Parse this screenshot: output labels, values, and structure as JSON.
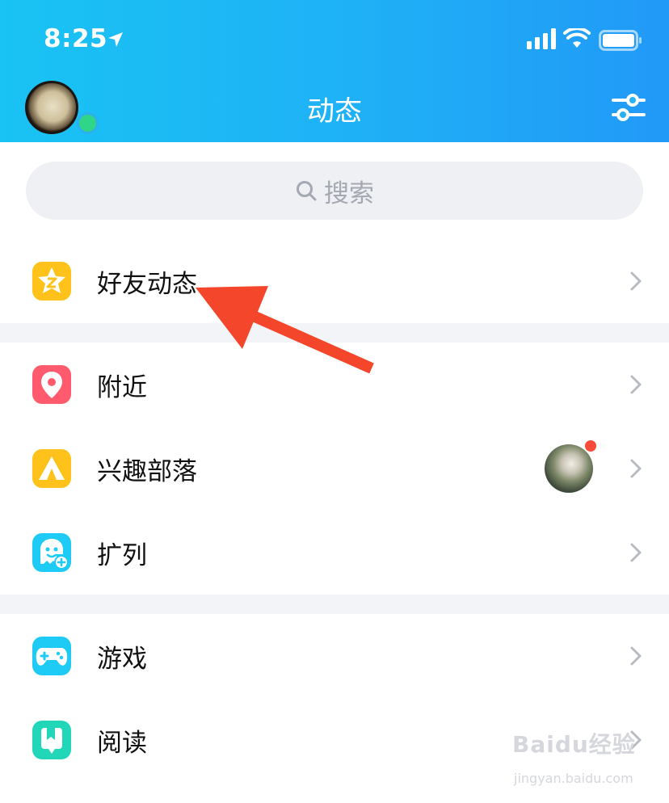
{
  "status_bar": {
    "time": "8:25"
  },
  "header": {
    "title": "动态"
  },
  "search": {
    "placeholder": "搜索"
  },
  "menu": {
    "friends": {
      "label": "好友动态",
      "icon": "star-icon",
      "color": "#FFC21A"
    },
    "nearby": {
      "label": "附近",
      "icon": "location-pin-icon",
      "color": "#FF5A6E"
    },
    "tribe": {
      "label": "兴趣部落",
      "icon": "tent-icon",
      "color": "#FFC21A"
    },
    "expand": {
      "label": "扩列",
      "icon": "ghost-add-icon",
      "color": "#1ECBF5"
    },
    "games": {
      "label": "游戏",
      "icon": "gamepad-icon",
      "color": "#1ECBF5"
    },
    "reading": {
      "label": "阅读",
      "icon": "book-icon",
      "color": "#22D6B8"
    }
  },
  "watermark": {
    "main": "Baidu经验",
    "sub": "jingyan.baidu.com"
  },
  "colors": {
    "header_start": "#19C3F3",
    "header_end": "#2199F7",
    "annotation_arrow": "#F4462A",
    "notification_dot": "#FA4A3A"
  }
}
